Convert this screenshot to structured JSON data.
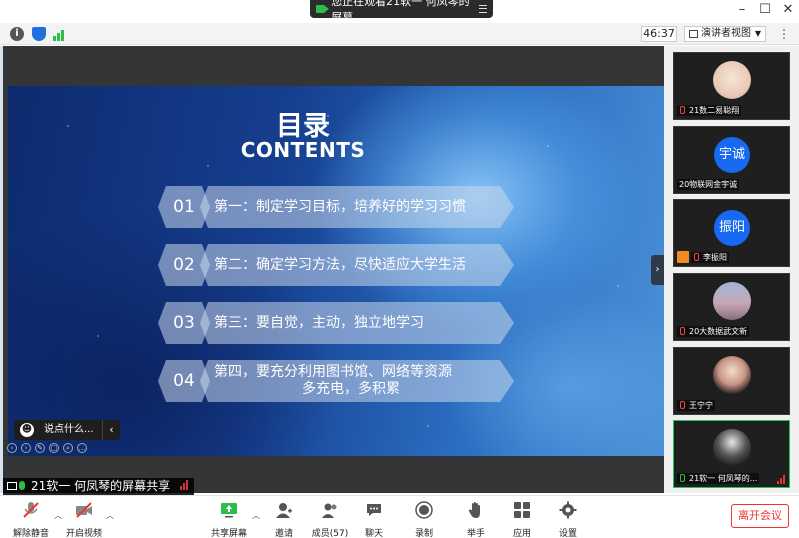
{
  "window": {
    "title": "您正在观看21软一 何凤琴的屏幕",
    "controls": [
      "minimize",
      "maximize",
      "close"
    ]
  },
  "topbar": {
    "timer": "46:37",
    "view_mode": "演讲者视图"
  },
  "slide": {
    "title": "目录",
    "subtitle": "CONTENTS",
    "items": [
      {
        "num": "01",
        "text": "第一：制定学习目标，培养好的学习习惯"
      },
      {
        "num": "02",
        "text": "第二：确定学习方法，尽快适应大学生活"
      },
      {
        "num": "03",
        "text": "第三：要自觉，主动，独立地学习"
      },
      {
        "num": "04",
        "line1": "第四，要充分利用图书馆、网络等资源",
        "line2": "多充电，多积累"
      }
    ]
  },
  "chat_popup": {
    "placeholder": "说点什么..."
  },
  "sharer_label": "21软一 何凤琴的屏幕共享",
  "participants": [
    {
      "name": "21数二易聪翔",
      "avatar": "photo"
    },
    {
      "name": "20物联网金宇诚",
      "avatar_text": "宇诚"
    },
    {
      "name": "李振阳",
      "avatar_text": "振阳"
    },
    {
      "name": "20大数据武文新",
      "avatar": "photo"
    },
    {
      "name": "王宁宁",
      "avatar": "photo"
    },
    {
      "name": "21软一 何凤琴的...",
      "avatar": "photo"
    }
  ],
  "toolbar": {
    "mute": "解除静音",
    "video": "开启视频",
    "share": "共享屏幕",
    "invite": "邀请",
    "members": "成员(57)",
    "chat": "聊天",
    "record": "录制",
    "raise_hand": "举手",
    "apps": "应用",
    "settings": "设置",
    "leave": "离开会议"
  },
  "colors": {
    "accent_green": "#2fbd4a",
    "leave_red": "#e33333",
    "avatar_blue": "#1669f0"
  }
}
